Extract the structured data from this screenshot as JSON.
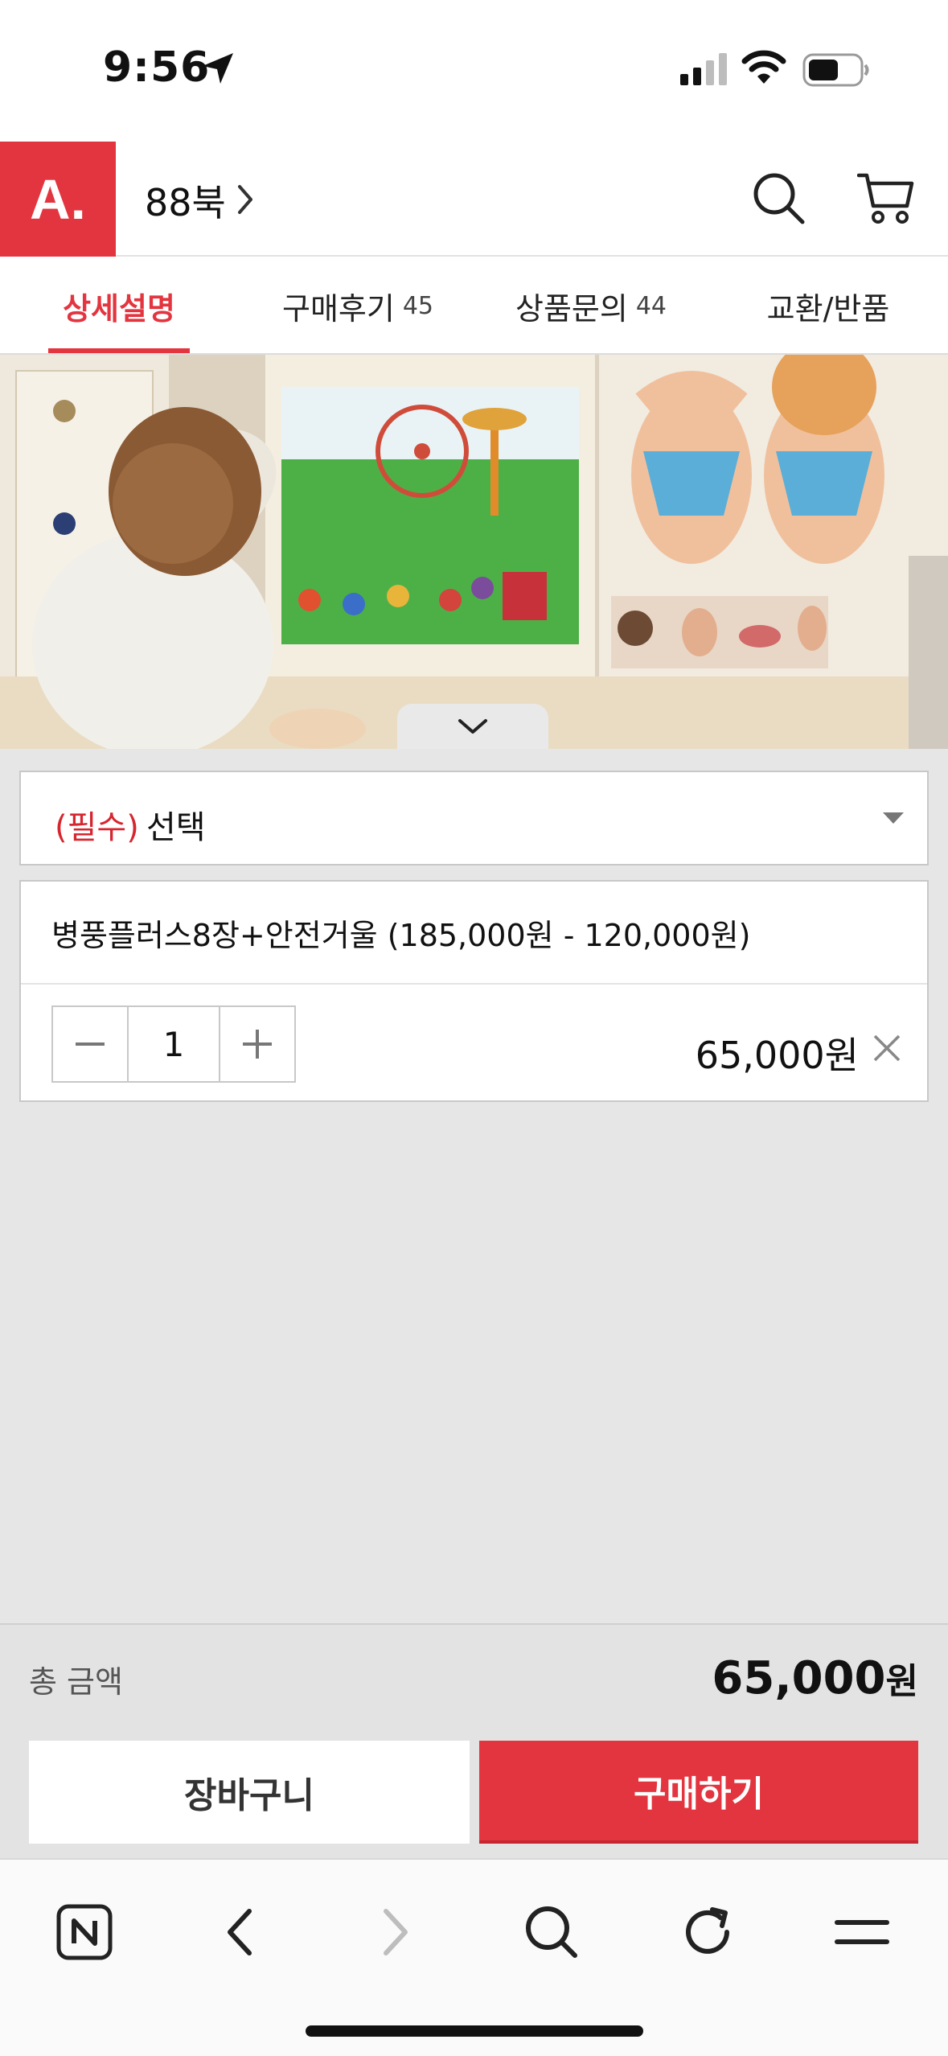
{
  "status_bar": {
    "time": "9:56"
  },
  "header": {
    "logo_text": "A.",
    "store_name": "88북"
  },
  "tabs": [
    {
      "label": "상세설명",
      "count": ""
    },
    {
      "label": "구매후기",
      "count": "45"
    },
    {
      "label": "상품문의",
      "count": "44"
    },
    {
      "label": "교환/반품",
      "count": ""
    }
  ],
  "option_select": {
    "required_label": "(필수)",
    "placeholder": "선택"
  },
  "selected_option": {
    "name": "병풍플러스8장+안전거울 (185,000원 - 120,000원)",
    "quantity": "1",
    "price": "65,000원"
  },
  "total": {
    "label": "총 금액",
    "amount": "65,000",
    "unit": "원"
  },
  "actions": {
    "cart_label": "장바구니",
    "buy_label": "구매하기"
  },
  "colors": {
    "brand": "#e3353f",
    "required": "#d6262f"
  },
  "icons": {
    "browser_toolbar": [
      "naver-home-icon",
      "back-icon",
      "forward-icon",
      "search-icon",
      "refresh-icon",
      "menu-icon"
    ]
  }
}
